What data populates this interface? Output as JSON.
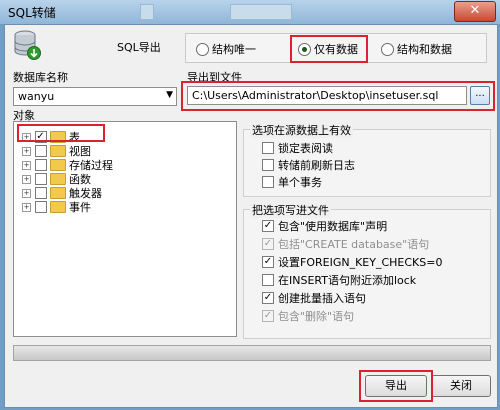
{
  "window": {
    "title": "SQL转储",
    "close_glyph": "✕"
  },
  "header": {
    "export_label": "SQL导出"
  },
  "export_mode": {
    "options": [
      {
        "label": "结构唯一",
        "selected": false
      },
      {
        "label": "仅有数据",
        "selected": true
      },
      {
        "label": "结构和数据",
        "selected": false
      }
    ]
  },
  "database": {
    "label": "数据库名称",
    "value": "wanyu",
    "arrow": "▼"
  },
  "export_file": {
    "label": "导出到文件",
    "path": "C:\\Users\\Administrator\\Desktop\\insetuser.sql",
    "browse_label": "..."
  },
  "objects": {
    "label": "对象",
    "items": [
      {
        "label": "表",
        "checked": true
      },
      {
        "label": "视图",
        "checked": false
      },
      {
        "label": "存储过程",
        "checked": false
      },
      {
        "label": "函数",
        "checked": false
      },
      {
        "label": "触发器",
        "checked": false
      },
      {
        "label": "事件",
        "checked": false
      }
    ]
  },
  "source_options": {
    "title": "选项在源数据上有效",
    "items": [
      {
        "label": "锁定表阅读",
        "checked": false,
        "enabled": true
      },
      {
        "label": "转储前刷新日志",
        "checked": false,
        "enabled": true
      },
      {
        "label": "单个事务",
        "checked": false,
        "enabled": true
      }
    ]
  },
  "file_options": {
    "title": "把选项写进文件",
    "items": [
      {
        "label": "包含\"使用数据库\"声明",
        "checked": true,
        "enabled": true
      },
      {
        "label": "包括\"CREATE database\"语句",
        "checked": true,
        "enabled": false
      },
      {
        "label": "设置FOREIGN_KEY_CHECKS=0",
        "checked": true,
        "enabled": true
      },
      {
        "label": "在INSERT语句附近添加lock",
        "checked": false,
        "enabled": true
      },
      {
        "label": "创建批量插入语句",
        "checked": true,
        "enabled": true
      },
      {
        "label": "包含\"删除\"语句",
        "checked": true,
        "enabled": false
      }
    ]
  },
  "progress": {
    "value": 0
  },
  "buttons": {
    "export": "导出",
    "cancel": "关闭"
  },
  "colors": {
    "highlight": "#d9232e",
    "check": "#1c5a1c"
  }
}
